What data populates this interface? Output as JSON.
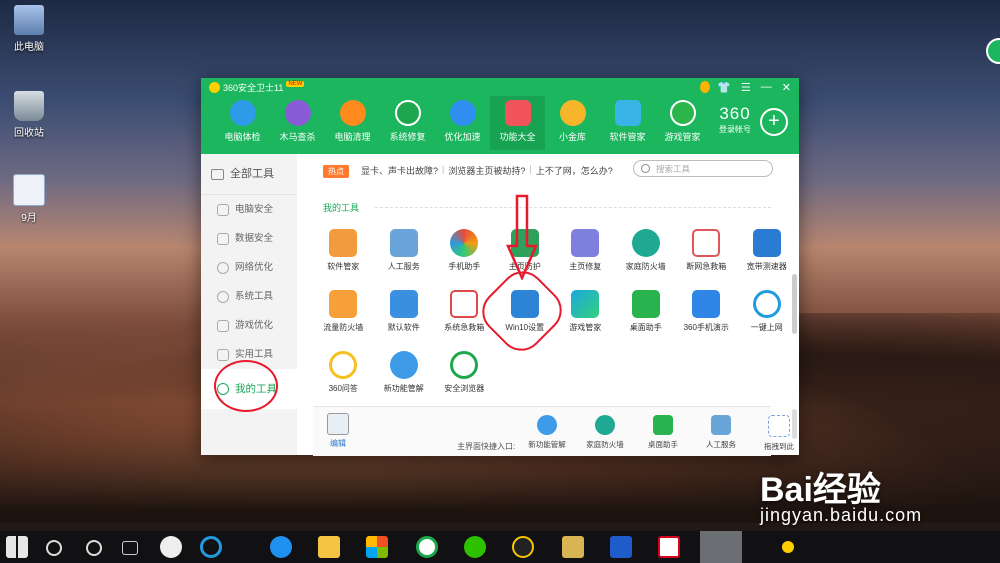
{
  "desktop": {
    "icons": [
      {
        "label": "此电脑",
        "color": "#c9d6e8"
      },
      {
        "label": "回收站",
        "color": "#9aa9b6"
      },
      {
        "label": "9月",
        "color": "#e9eef6"
      }
    ]
  },
  "window": {
    "title": "360安全卫士11",
    "new_badge": "NEW",
    "controls": [
      "👕",
      "☰",
      "—",
      "✕"
    ],
    "nav": [
      {
        "label": "电脑体检",
        "color": "#2d9be8",
        "active": false
      },
      {
        "label": "木马查杀",
        "color": "#8a5bd6",
        "active": false
      },
      {
        "label": "电脑清理",
        "color": "#ff8b1f",
        "active": false
      },
      {
        "label": "系统修复",
        "color": "#1ea64f",
        "active": false
      },
      {
        "label": "优化加速",
        "color": "#2f8ef0",
        "active": false
      },
      {
        "label": "功能大全",
        "color": "#f2545b",
        "active": true
      },
      {
        "label": "小金库",
        "color": "#f7b52a",
        "active": false
      },
      {
        "label": "软件管家",
        "color": "#3ab4e6",
        "active": false
      },
      {
        "label": "游戏管家",
        "color": "#2bb54a",
        "active": false
      }
    ],
    "login_brand": "360",
    "login_label": "登录帐号"
  },
  "sidebar": {
    "all_label": "全部工具",
    "items": [
      {
        "label": "电脑安全"
      },
      {
        "label": "数据安全"
      },
      {
        "label": "网络优化"
      },
      {
        "label": "系统工具"
      },
      {
        "label": "游戏优化"
      },
      {
        "label": "实用工具"
      }
    ],
    "active_label": "我的工具"
  },
  "main": {
    "hot_badge": "热点",
    "tips": [
      "显卡、声卡出故障?",
      "浏览器主页被劫持?",
      "上不了网，怎么办?"
    ],
    "search_placeholder": "搜索工具",
    "section_title": "我的工具",
    "tools": [
      {
        "label": "软件管家",
        "color": "#f29b3c"
      },
      {
        "label": "人工服务",
        "color": "#6aa5d9"
      },
      {
        "label": "手机助手",
        "color": "#3cc06a"
      },
      {
        "label": "主页防护",
        "color": "#2ea15c"
      },
      {
        "label": "主页修复",
        "color": "#7f7fe0"
      },
      {
        "label": "家庭防火墙",
        "color": "#1fa993"
      },
      {
        "label": "断网急救箱",
        "color": "#e3555a"
      },
      {
        "label": "宽带测速器",
        "color": "#2a7bd2"
      },
      {
        "label": "流量防火墙",
        "color": "#f7a03a"
      },
      {
        "label": "默认软件",
        "color": "#3a8fe0"
      },
      {
        "label": "系统急救箱",
        "color": "#e24b4b"
      },
      {
        "label": "Win10设置",
        "color": "#2d83d6"
      },
      {
        "label": "游戏管家",
        "color": "#19a8e0"
      },
      {
        "label": "桌面助手",
        "color": "#29b34f"
      },
      {
        "label": "360手机演示",
        "color": "#2f86e6"
      },
      {
        "label": "一键上网",
        "color": "#1f9be0"
      },
      {
        "label": "360问答",
        "color": "#f6c11f"
      },
      {
        "label": "新功能管解",
        "color": "#3d9be8"
      },
      {
        "label": "安全浏览器",
        "color": "#1ea84d"
      }
    ],
    "edit_label": "编辑",
    "quick_label": "主界面快捷入口:",
    "quick": [
      {
        "label": "新功能管解",
        "color": "#3d9be8"
      },
      {
        "label": "家庭防火墙",
        "color": "#1fa993"
      },
      {
        "label": "桌面助手",
        "color": "#29b34f"
      },
      {
        "label": "人工服务",
        "color": "#6aa5d9"
      },
      {
        "label": "拖拽到此",
        "color": "#ffffff"
      }
    ]
  },
  "taskbar": {
    "apps": [
      "start",
      "search",
      "cortana",
      "task-view",
      "fan",
      "ie",
      "edge",
      "explorer",
      "store",
      "360browser",
      "wechat",
      "qq",
      "gold",
      "game",
      "red",
      "360safe"
    ]
  },
  "watermark": {
    "main": "Bai经验",
    "sub": "jingyan.baidu.com"
  }
}
